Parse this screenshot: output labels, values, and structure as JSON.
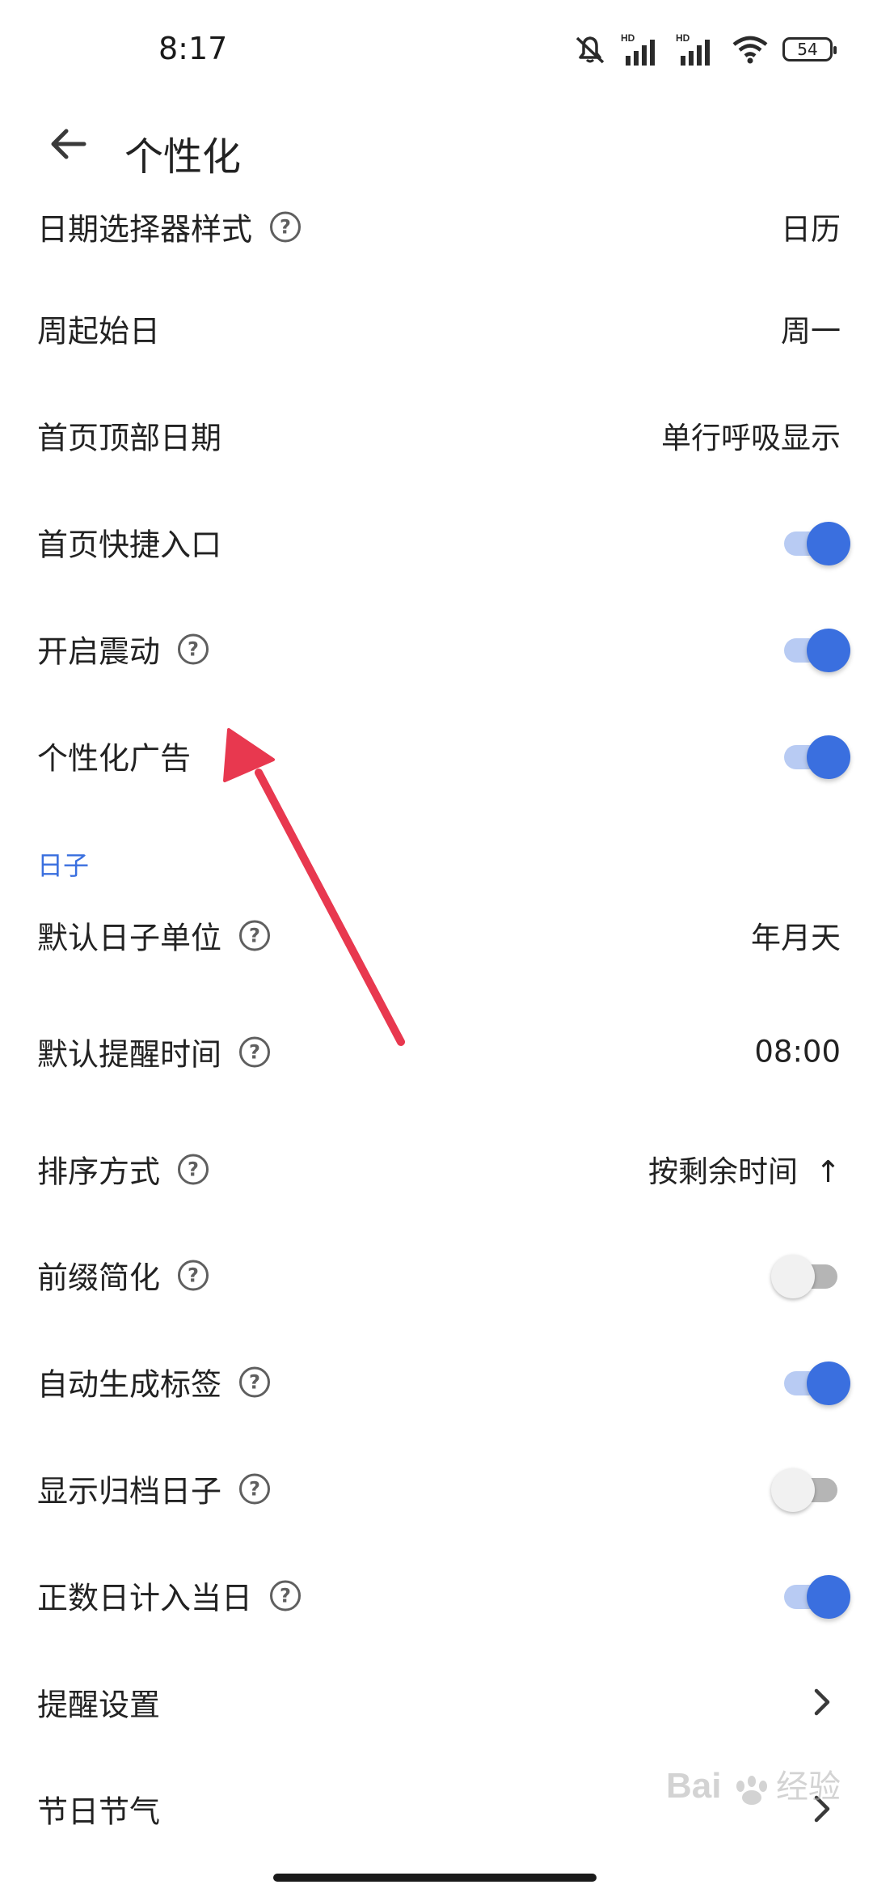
{
  "status_bar": {
    "time": "8:17",
    "battery": "54",
    "signal_label_1": "HD",
    "signal_label_2": "HD"
  },
  "header": {
    "title": "个性化"
  },
  "colors": {
    "accent": "#3a6fdf",
    "accent_track": "#b8cbf3",
    "annotation": "#e8384f"
  },
  "rows": [
    {
      "label": "日期选择器样式",
      "help": true,
      "value": "日历"
    },
    {
      "label": "周起始日",
      "help": false,
      "value": "周一"
    },
    {
      "label": "首页顶部日期",
      "help": false,
      "value": "单行呼吸显示"
    },
    {
      "label": "首页快捷入口",
      "help": false,
      "toggle": "on"
    },
    {
      "label": "开启震动",
      "help": true,
      "toggle": "on"
    },
    {
      "label": "个性化广告",
      "help": false,
      "toggle": "on"
    }
  ],
  "section_days": {
    "title": "日子"
  },
  "day_rows": [
    {
      "label": "默认日子单位",
      "help": true,
      "value": "年月天"
    },
    {
      "label": "默认提醒时间",
      "help": true,
      "value": "08:00"
    },
    {
      "label": "排序方式",
      "help": true,
      "value": "按剩余时间",
      "arrow": "↑"
    },
    {
      "label": "前缀简化",
      "help": true,
      "toggle": "off"
    },
    {
      "label": "自动生成标签",
      "help": true,
      "toggle": "on"
    },
    {
      "label": "显示归档日子",
      "help": true,
      "toggle": "off"
    },
    {
      "label": "正数日计入当日",
      "help": true,
      "toggle": "on"
    },
    {
      "label": "提醒设置",
      "help": false,
      "chevron": true
    },
    {
      "label": "节日节气",
      "help": false,
      "chevron": true
    }
  ],
  "help_glyph": "?",
  "watermark": {
    "brand": "Baidu",
    "suffix": "经验",
    "url": "jingyan.baidu.com"
  }
}
